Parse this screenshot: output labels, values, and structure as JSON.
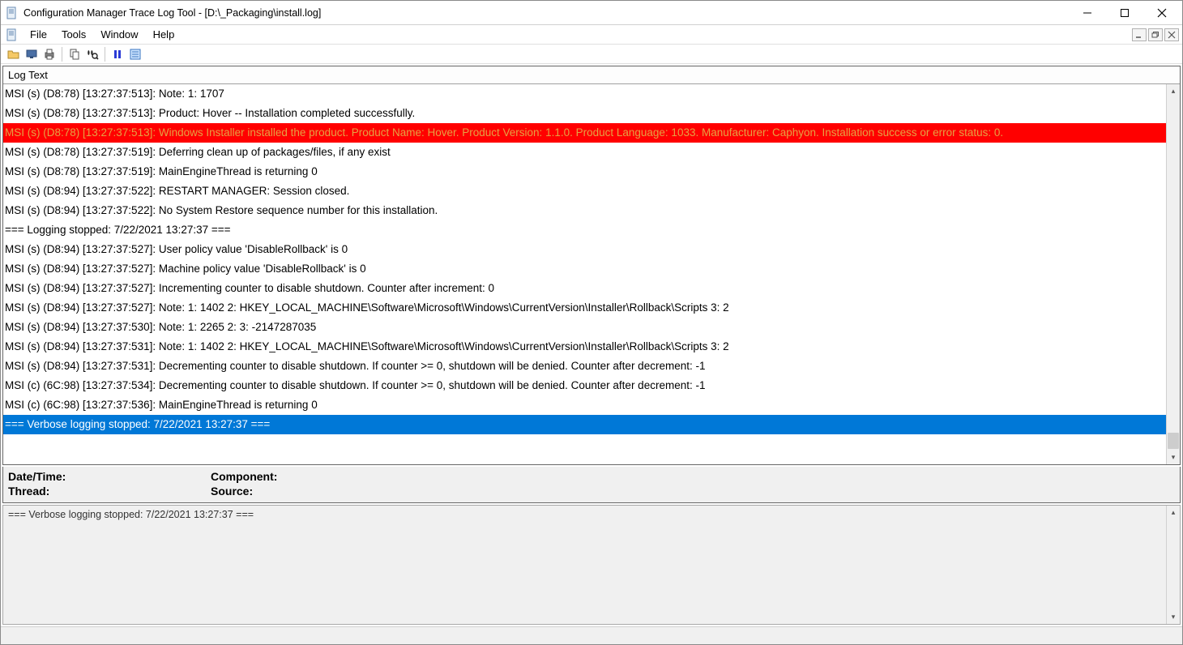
{
  "window": {
    "title": "Configuration Manager Trace Log Tool - [D:\\_Packaging\\install.log]"
  },
  "menus": {
    "file": "File",
    "tools": "Tools",
    "window": "Window",
    "help": "Help"
  },
  "toolbar_icons": {
    "open": "open-icon",
    "open_on_server": "open-on-server-icon",
    "print": "print-icon",
    "copy": "copy-icon",
    "find": "find-icon",
    "pause": "pause-icon",
    "highlight": "highlight-icon"
  },
  "log": {
    "header": "Log Text",
    "lines": [
      {
        "text": "MSI (s) (D8:78) [13:27:37:513]: Note: 1: 1707",
        "hl": ""
      },
      {
        "text": "MSI (s) (D8:78) [13:27:37:513]: Product: Hover -- Installation completed successfully.",
        "hl": ""
      },
      {
        "text": "MSI (s) (D8:78) [13:27:37:513]: Windows Installer installed the product. Product Name: Hover. Product Version: 1.1.0. Product Language: 1033. Manufacturer: Caphyon. Installation success or error status: 0.",
        "hl": "error"
      },
      {
        "text": "MSI (s) (D8:78) [13:27:37:519]: Deferring clean up of packages/files, if any exist",
        "hl": ""
      },
      {
        "text": "MSI (s) (D8:78) [13:27:37:519]: MainEngineThread is returning 0",
        "hl": ""
      },
      {
        "text": "MSI (s) (D8:94) [13:27:37:522]: RESTART MANAGER: Session closed.",
        "hl": ""
      },
      {
        "text": "MSI (s) (D8:94) [13:27:37:522]: No System Restore sequence number for this installation.",
        "hl": ""
      },
      {
        "text": "=== Logging stopped: 7/22/2021  13:27:37 ===",
        "hl": ""
      },
      {
        "text": "MSI (s) (D8:94) [13:27:37:527]: User policy value 'DisableRollback' is 0",
        "hl": ""
      },
      {
        "text": "MSI (s) (D8:94) [13:27:37:527]: Machine policy value 'DisableRollback' is 0",
        "hl": ""
      },
      {
        "text": "MSI (s) (D8:94) [13:27:37:527]: Incrementing counter to disable shutdown. Counter after increment: 0",
        "hl": ""
      },
      {
        "text": "MSI (s) (D8:94) [13:27:37:527]: Note: 1: 1402 2: HKEY_LOCAL_MACHINE\\Software\\Microsoft\\Windows\\CurrentVersion\\Installer\\Rollback\\Scripts 3: 2",
        "hl": ""
      },
      {
        "text": "MSI (s) (D8:94) [13:27:37:530]: Note: 1: 2265 2:  3: -2147287035",
        "hl": ""
      },
      {
        "text": "MSI (s) (D8:94) [13:27:37:531]: Note: 1: 1402 2: HKEY_LOCAL_MACHINE\\Software\\Microsoft\\Windows\\CurrentVersion\\Installer\\Rollback\\Scripts 3: 2",
        "hl": ""
      },
      {
        "text": "MSI (s) (D8:94) [13:27:37:531]: Decrementing counter to disable shutdown. If counter >= 0, shutdown will be denied.  Counter after decrement: -1",
        "hl": ""
      },
      {
        "text": "MSI (c) (6C:98) [13:27:37:534]: Decrementing counter to disable shutdown. If counter >= 0, shutdown will be denied.  Counter after decrement: -1",
        "hl": ""
      },
      {
        "text": "MSI (c) (6C:98) [13:27:37:536]: MainEngineThread is returning 0",
        "hl": ""
      },
      {
        "text": "=== Verbose logging stopped: 7/22/2021  13:27:37 ===",
        "hl": "selected"
      }
    ]
  },
  "details": {
    "date_time_label": "Date/Time:",
    "date_time_value": "",
    "component_label": "Component:",
    "component_value": "",
    "thread_label": "Thread:",
    "thread_value": "",
    "source_label": "Source:",
    "source_value": ""
  },
  "bottom": {
    "text": "=== Verbose logging stopped: 7/22/2021  13:27:37 ==="
  }
}
